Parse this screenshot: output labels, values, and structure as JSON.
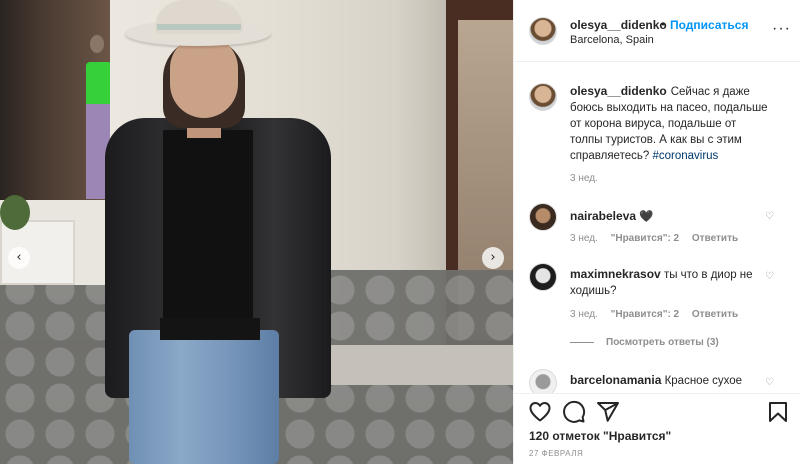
{
  "post": {
    "author": "olesya__didenko",
    "follow_label": "Подписаться",
    "separator": "•",
    "location": "Barcelona, Spain",
    "more_icon": "more-options-icon",
    "more_glyph": "···",
    "photo_nav": {
      "prev_glyph": "‹",
      "next_glyph": "›"
    }
  },
  "caption": {
    "username": "olesya__didenko",
    "text": "Сейчас я даже боюсь выходить на пасео, подальше от корона вируса, подальше от толпы туристов. А как вы с этим справляетесь?",
    "hashtag": "#coronavirus",
    "time": "3 нед."
  },
  "comments": [
    {
      "username": "nairabeleva",
      "text": "🖤",
      "time": "3 нед.",
      "likes": "\"Нравится\": 2",
      "reply": "Ответить",
      "heart_glyph": "♡"
    },
    {
      "username": "maximnekrasov",
      "text": "ты что в диор не ходишь?",
      "time": "3 нед.",
      "likes": "\"Нравится\": 2",
      "reply": "Ответить",
      "heart_glyph": "♡",
      "view_replies": "Посмотреть ответы (3)"
    },
    {
      "username": "barcelonamania",
      "text": "Красное сухое",
      "heart_glyph": "♡"
    }
  ],
  "actions": {
    "likes_count": "120 отметок \"Нравится\"",
    "date": "27 ФЕВРАЛЯ",
    "icons": [
      "heart-icon",
      "comment-icon",
      "share-icon",
      "bookmark-icon"
    ]
  },
  "colors": {
    "link": "#0095f6",
    "hashtag": "#00376b",
    "muted": "#8e8e8e",
    "text": "#262626"
  }
}
